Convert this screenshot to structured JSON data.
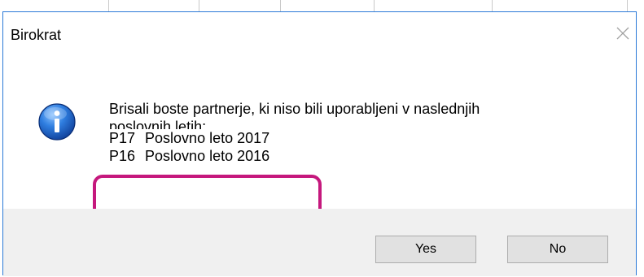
{
  "dialog": {
    "title": "Birokrat",
    "message_lines": [
      "Brisali boste partnerje, ki niso bili uporabljeni v naslednjih",
      "poslovnih letih:"
    ],
    "years": [
      {
        "code": "P17",
        "label": "Poslovno leto 2017"
      },
      {
        "code": "P16",
        "label": "Poslovno leto 2016"
      }
    ],
    "buttons": {
      "yes": "Yes",
      "no": "No"
    }
  },
  "colors": {
    "border": "#2b79d7",
    "highlight": "#c5187d",
    "footer": "#f0f0f0",
    "info_icon": "#1f5fbf"
  },
  "icons": {
    "info": "info-icon",
    "close": "close-icon"
  }
}
